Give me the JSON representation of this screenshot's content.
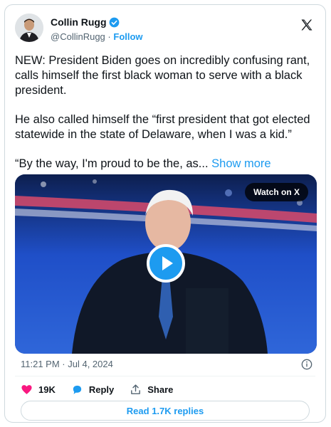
{
  "author": {
    "display_name": "Collin Rugg",
    "handle": "@CollinRugg",
    "separator": "·",
    "follow_label": "Follow"
  },
  "post": {
    "paragraph1": "NEW: President Biden goes on incredibly confusing rant, calls himself the first black woman to serve with a black president.",
    "paragraph2": "He also called himself the “first president that got elected statewide in the state of Delaware, when I was a kid.”",
    "paragraph3": "“By the way, I'm proud to be the, as...",
    "show_more_label": "Show more"
  },
  "media": {
    "watch_label": "Watch on X"
  },
  "meta": {
    "timestamp": "11:21 PM · Jul 4, 2024"
  },
  "actions": {
    "like_count": "19K",
    "reply_label": "Reply",
    "share_label": "Share",
    "read_replies_label": "Read 1.7K replies"
  },
  "colors": {
    "accent": "#1d9bf0",
    "like": "#f91880",
    "text": "#0f1419",
    "muted": "#536471"
  },
  "icons": [
    "verified-badge-icon",
    "x-logo-icon",
    "play-icon",
    "info-icon",
    "heart-icon",
    "reply-bubble-icon",
    "share-icon"
  ]
}
